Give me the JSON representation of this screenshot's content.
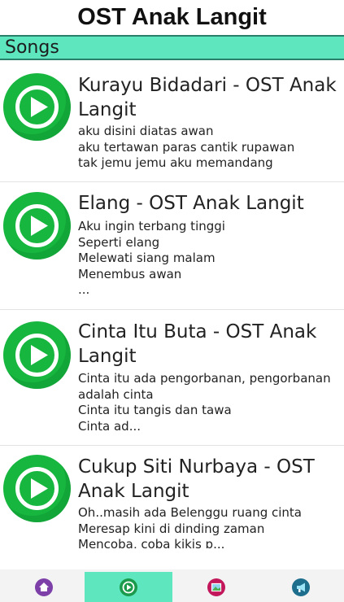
{
  "app": {
    "title": "OST Anak Langit"
  },
  "section": {
    "label": "Songs"
  },
  "songs": [
    {
      "title": "Kurayu Bidadari - OST Anak Langit",
      "lyrics": "aku disini diatas awan\naku tertawan paras cantik rupawan\ntak jemu jemu aku memandang"
    },
    {
      "title": "Elang - OST Anak Langit",
      "lyrics": "Aku ingin terbang tinggi\nSeperti elang\nMelewati siang malam\nMenembus awan\n..."
    },
    {
      "title": "Cinta Itu Buta - OST Anak Langit",
      "lyrics": "Cinta itu ada pengorbanan, pengorbanan adalah cinta\nCinta itu tangis dan tawa\nCinta ad..."
    },
    {
      "title": "Cukup Siti Nurbaya - OST Anak Langit",
      "lyrics": "Oh..masih ada Belenggu ruang cinta\nMeresap kini di dinding zaman\nMencoba, coba kikis p..."
    }
  ],
  "nav": {
    "items": [
      {
        "icon": "home-icon",
        "color": "#7d3fa8"
      },
      {
        "icon": "play-icon",
        "color": "#1a9a4a",
        "active": true
      },
      {
        "icon": "image-icon",
        "color": "#c2185b"
      },
      {
        "icon": "megaphone-icon",
        "color": "#1c6e8c"
      }
    ]
  },
  "colors": {
    "accent": "#5ee6bf",
    "play": "#16b63f"
  }
}
